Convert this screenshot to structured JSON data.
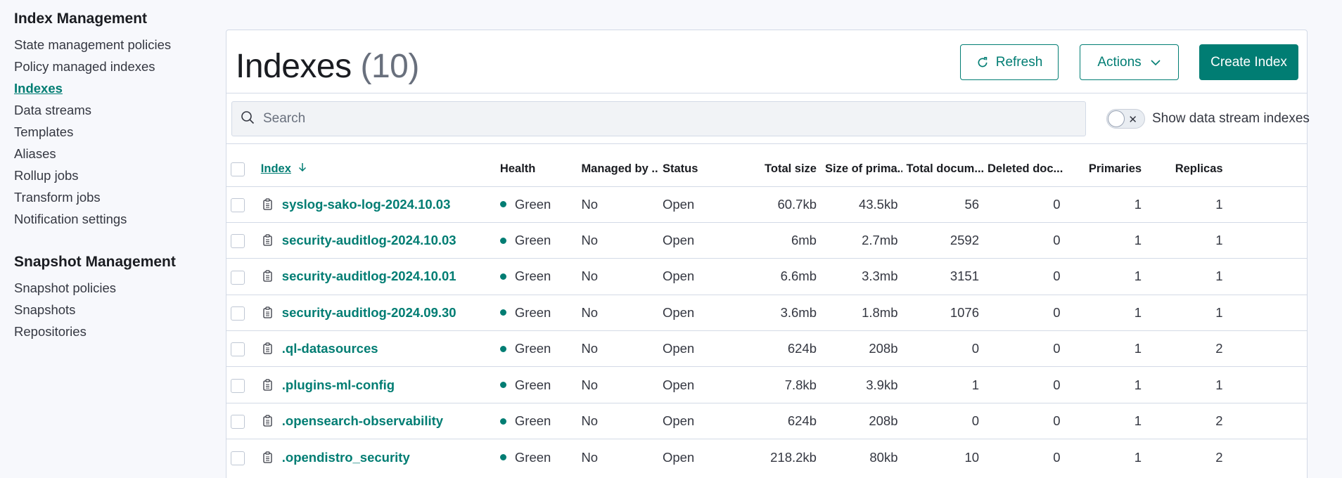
{
  "sidebar": {
    "sections": [
      {
        "title": "Index Management",
        "items": [
          {
            "label": "State management policies",
            "active": false
          },
          {
            "label": "Policy managed indexes",
            "active": false
          },
          {
            "label": "Indexes",
            "active": true
          },
          {
            "label": "Data streams",
            "active": false
          },
          {
            "label": "Templates",
            "active": false
          },
          {
            "label": "Aliases",
            "active": false
          },
          {
            "label": "Rollup jobs",
            "active": false
          },
          {
            "label": "Transform jobs",
            "active": false
          },
          {
            "label": "Notification settings",
            "active": false
          }
        ]
      },
      {
        "title": "Snapshot Management",
        "items": [
          {
            "label": "Snapshot policies",
            "active": false
          },
          {
            "label": "Snapshots",
            "active": false
          },
          {
            "label": "Repositories",
            "active": false
          }
        ]
      }
    ]
  },
  "page": {
    "title": "Indexes",
    "count": "(10)",
    "refresh_label": "Refresh",
    "actions_label": "Actions",
    "create_label": "Create Index",
    "search_placeholder": "Search",
    "toggle_label": "Show data stream indexes",
    "toggle_on": false
  },
  "table": {
    "columns": [
      "Index",
      "Health",
      "Managed by ...",
      "Status",
      "Total size",
      "Size of prima...",
      "Total docum...",
      "Deleted doc...",
      "Primaries",
      "Replicas"
    ],
    "sort": {
      "column": "Index",
      "direction": "descending"
    },
    "rows": [
      {
        "index": "syslog-sako-log-2024.10.03",
        "health": "Green",
        "managed": "No",
        "status": "Open",
        "total_size": "60.7kb",
        "primary_size": "43.5kb",
        "total_docs": "56",
        "deleted_docs": "0",
        "primaries": "1",
        "replicas": "1",
        "highlighted": true
      },
      {
        "index": "security-auditlog-2024.10.03",
        "health": "Green",
        "managed": "No",
        "status": "Open",
        "total_size": "6mb",
        "primary_size": "2.7mb",
        "total_docs": "2592",
        "deleted_docs": "0",
        "primaries": "1",
        "replicas": "1"
      },
      {
        "index": "security-auditlog-2024.10.01",
        "health": "Green",
        "managed": "No",
        "status": "Open",
        "total_size": "6.6mb",
        "primary_size": "3.3mb",
        "total_docs": "3151",
        "deleted_docs": "0",
        "primaries": "1",
        "replicas": "1"
      },
      {
        "index": "security-auditlog-2024.09.30",
        "health": "Green",
        "managed": "No",
        "status": "Open",
        "total_size": "3.6mb",
        "primary_size": "1.8mb",
        "total_docs": "1076",
        "deleted_docs": "0",
        "primaries": "1",
        "replicas": "1"
      },
      {
        "index": ".ql-datasources",
        "health": "Green",
        "managed": "No",
        "status": "Open",
        "total_size": "624b",
        "primary_size": "208b",
        "total_docs": "0",
        "deleted_docs": "0",
        "primaries": "1",
        "replicas": "2"
      },
      {
        "index": ".plugins-ml-config",
        "health": "Green",
        "managed": "No",
        "status": "Open",
        "total_size": "7.8kb",
        "primary_size": "3.9kb",
        "total_docs": "1",
        "deleted_docs": "0",
        "primaries": "1",
        "replicas": "1"
      },
      {
        "index": ".opensearch-observability",
        "health": "Green",
        "managed": "No",
        "status": "Open",
        "total_size": "624b",
        "primary_size": "208b",
        "total_docs": "0",
        "deleted_docs": "0",
        "primaries": "1",
        "replicas": "2"
      },
      {
        "index": ".opendistro_security",
        "health": "Green",
        "managed": "No",
        "status": "Open",
        "total_size": "218.2kb",
        "primary_size": "80kb",
        "total_docs": "10",
        "deleted_docs": "0",
        "primaries": "1",
        "replicas": "2"
      }
    ]
  },
  "colors": {
    "accent": "#017d73",
    "highlight": "#fbfb1c",
    "health_green": "#017d73",
    "background": "#f7f8fc",
    "border": "#d3dae6"
  },
  "icons": {
    "refresh": "refresh-icon",
    "actions": "chevron-down-icon",
    "search": "search-icon",
    "index": "index-icon",
    "sort": "arrow-down-icon",
    "toggle": "close-icon"
  }
}
